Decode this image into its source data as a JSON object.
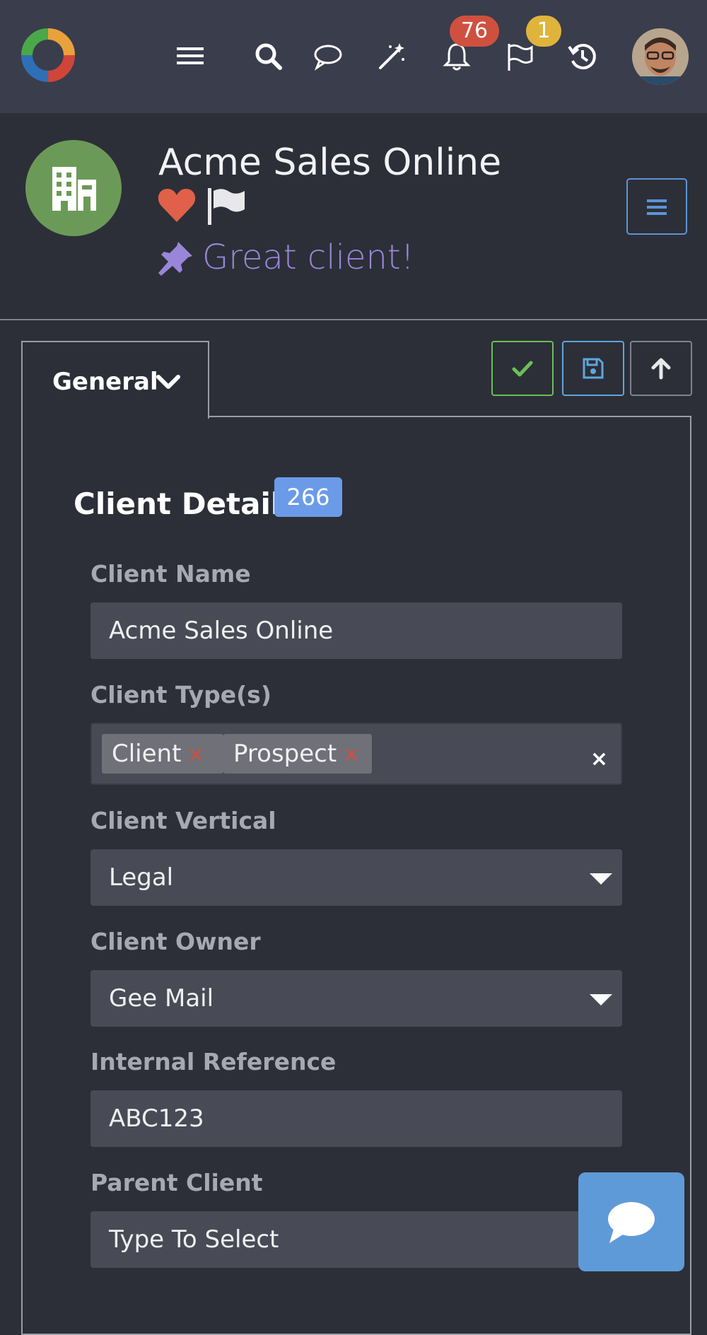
{
  "topbar": {
    "icons": [
      "logo",
      "hamburger-icon",
      "search-icon",
      "chat-bubble-icon",
      "magic-wand-icon",
      "bell-icon",
      "flag-icon",
      "history-icon",
      "user-avatar"
    ],
    "notification_count": "76",
    "flag_count": "1"
  },
  "header": {
    "client_name": "Acme Sales Online",
    "note": "Great client!",
    "icons": [
      "building-icon",
      "heart-icon",
      "flag-icon",
      "pin-icon",
      "menu-icon"
    ],
    "colors": {
      "avatar": "#6b9a58",
      "heart": "#e0604a",
      "note": "#9a86d8"
    }
  },
  "tabs": [
    {
      "label": "General",
      "icon": "chevron-down-icon"
    }
  ],
  "actions": [
    "check-icon",
    "save-icon",
    "arrow-up-icon"
  ],
  "section": {
    "title": "Client Details",
    "count": "266"
  },
  "form": {
    "client_name": {
      "label": "Client Name",
      "value": "Acme Sales Online"
    },
    "client_types": {
      "label": "Client Type(s)",
      "tags": [
        "Client",
        "Prospect"
      ],
      "tag_remove": "×",
      "clear": "×"
    },
    "client_vertical": {
      "label": "Client Vertical",
      "value": "Legal"
    },
    "client_owner": {
      "label": "Client Owner",
      "value": "Gee Mail"
    },
    "internal_reference": {
      "label": "Internal Reference",
      "value": "ABC123"
    },
    "parent_client": {
      "label": "Parent Client",
      "value": "Type To Select"
    }
  },
  "chat_widget": {
    "icon": "chat-icon"
  }
}
